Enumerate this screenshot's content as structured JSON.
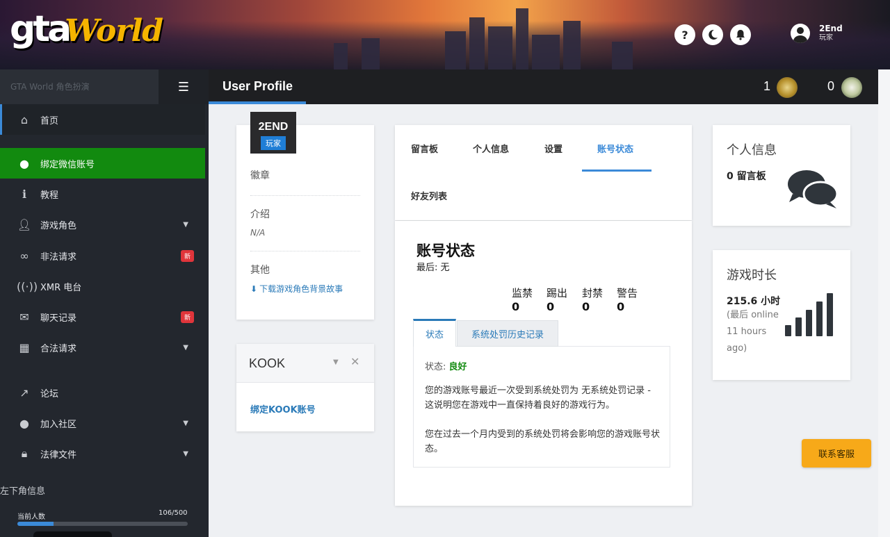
{
  "header": {
    "logo_main": "gta",
    "logo_sub": "World",
    "help_icon": "?",
    "user": {
      "name": "2End",
      "role": "玩家"
    }
  },
  "sidebar": {
    "title": "GTA World 角色扮演",
    "items": [
      {
        "label": "首页",
        "icon": "home-icon"
      },
      {
        "label": "绑定微信账号",
        "icon": "wechat-icon"
      },
      {
        "label": "教程",
        "icon": "info-icon"
      },
      {
        "label": "游戏角色",
        "icon": "user-icon"
      },
      {
        "label": "非法请求",
        "icon": "mask-icon",
        "badge": "新"
      },
      {
        "label": "XMR 电台",
        "icon": "radio-icon"
      },
      {
        "label": "聊天记录",
        "icon": "chat-icon",
        "badge": "新"
      },
      {
        "label": "合法请求",
        "icon": "building-icon"
      },
      {
        "label": "论坛",
        "icon": "external-link-icon"
      },
      {
        "label": "加入社区",
        "icon": "wechat-icon"
      },
      {
        "label": "法律文件",
        "icon": "lock-icon"
      }
    ],
    "section_label": "左下角信息",
    "online_label": "当前人数",
    "online_count": "106/500",
    "online_fraction": 0.212
  },
  "titlebar": {
    "title": "User Profile",
    "stat1": "1",
    "stat2": "0"
  },
  "profile_card": {
    "name": "2END",
    "role": "玩家",
    "badges_label": "徽章",
    "intro_label": "介绍",
    "intro_value": "N/A",
    "other_label": "其他",
    "download_link": "下载游戏角色背景故事"
  },
  "kook_card": {
    "title": "KOOK",
    "bind_link": "绑定KOOK账号"
  },
  "tabs": [
    "留言板",
    "个人信息",
    "设置",
    "账号状态",
    "好友列表"
  ],
  "account_status": {
    "heading": "账号状态",
    "last_label": "最后: 无",
    "stats": [
      {
        "label": "监禁",
        "value": "0"
      },
      {
        "label": "踢出",
        "value": "0"
      },
      {
        "label": "封禁",
        "value": "0"
      },
      {
        "label": "警告",
        "value": "0"
      }
    ],
    "subtabs": [
      "状态",
      "系统处罚历史记录"
    ],
    "status_label": "状态:",
    "status_value": "良好",
    "para1": "您的游戏账号最近一次受到系统处罚为 无系统处罚记录 - 这说明您在游戏中一直保持着良好的游戏行为。",
    "para2": "您在过去一个月内受到的系统处罚将会影响您的游戏账号状态。"
  },
  "info_card": {
    "title": "个人信息",
    "messages": "0 留言板"
  },
  "playtime_card": {
    "title": "游戏时长",
    "hours": "215.6 小时",
    "last_online": "(最后 online 11 hours ago)"
  },
  "contact_button": "联系客服",
  "colors": {
    "accent": "#3b8ad8",
    "green": "#128a0f",
    "badge": "#e0353b",
    "contact": "#f7a919"
  }
}
